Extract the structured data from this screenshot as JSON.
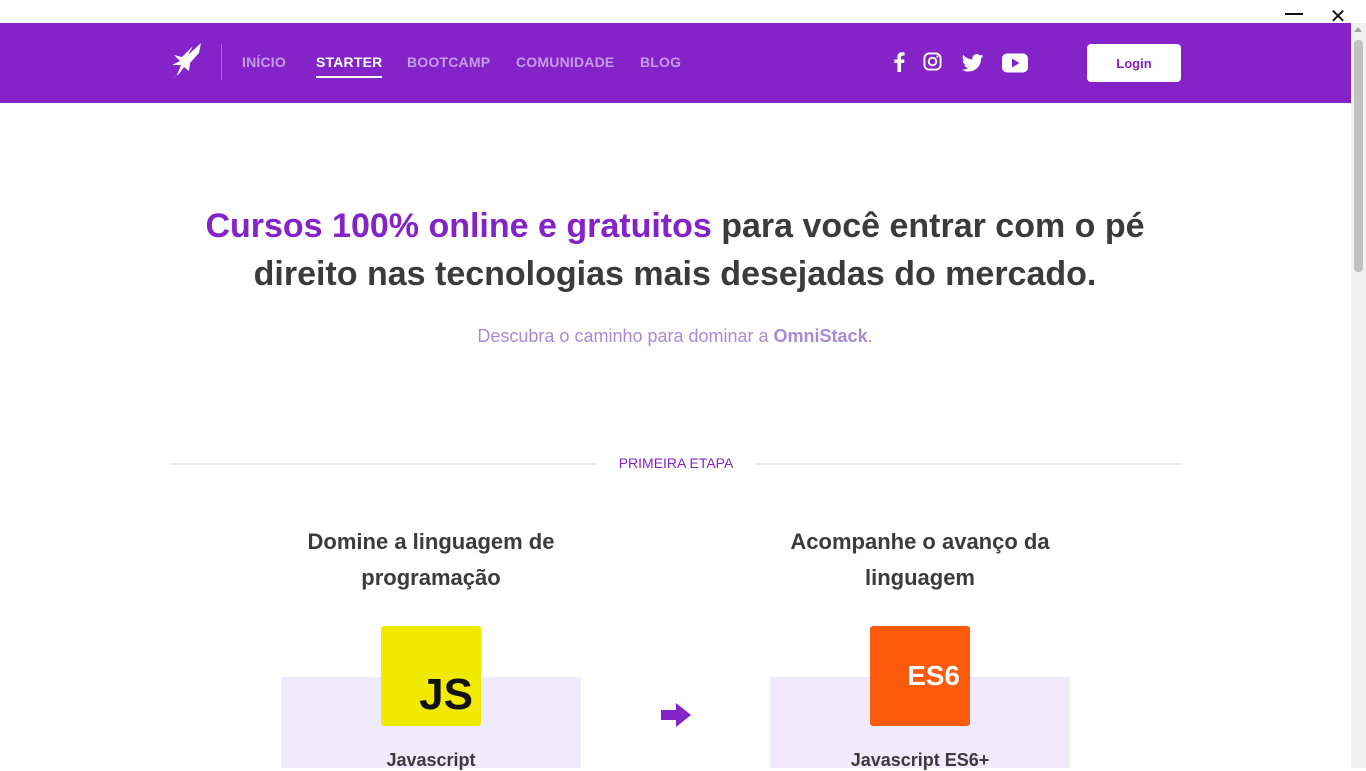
{
  "window": {
    "minimize_icon": "minimize-icon",
    "close_glyph": "✕"
  },
  "header": {
    "logo_icon": "rocketseat-logo-icon",
    "nav": [
      {
        "label": "INÍCIO",
        "active": false
      },
      {
        "label": "STARTER",
        "active": true
      },
      {
        "label": "BOOTCAMP",
        "active": false
      },
      {
        "label": "COMUNIDADE",
        "active": false
      },
      {
        "label": "BLOG",
        "active": false
      }
    ],
    "social": [
      "facebook-icon",
      "instagram-icon",
      "twitter-icon",
      "youtube-icon"
    ],
    "login_label": "Login",
    "colors": {
      "background": "#8323c8"
    }
  },
  "hero": {
    "title_highlight": "Cursos 100% online e gratuitos",
    "title_rest": " para você entrar com o pé direito nas tecnologias mais desejadas do mercado.",
    "subtitle_prefix": "Descubra o caminho para dominar a ",
    "subtitle_strong": "OmniStack",
    "subtitle_suffix": "."
  },
  "stage": {
    "label": "PRIMEIRA ETAPA",
    "columns": [
      {
        "title": "Domine a linguagem de programação",
        "badge_text": "JS",
        "badge_color": "#f0ea00",
        "name": "Javascript"
      },
      {
        "title": "Acompanhe o avanço da linguagem",
        "badge_text": "ES6",
        "badge_color": "#fb5a0d",
        "name": "Javascript ES6+"
      }
    ],
    "arrow_icon": "arrow-right-icon"
  }
}
